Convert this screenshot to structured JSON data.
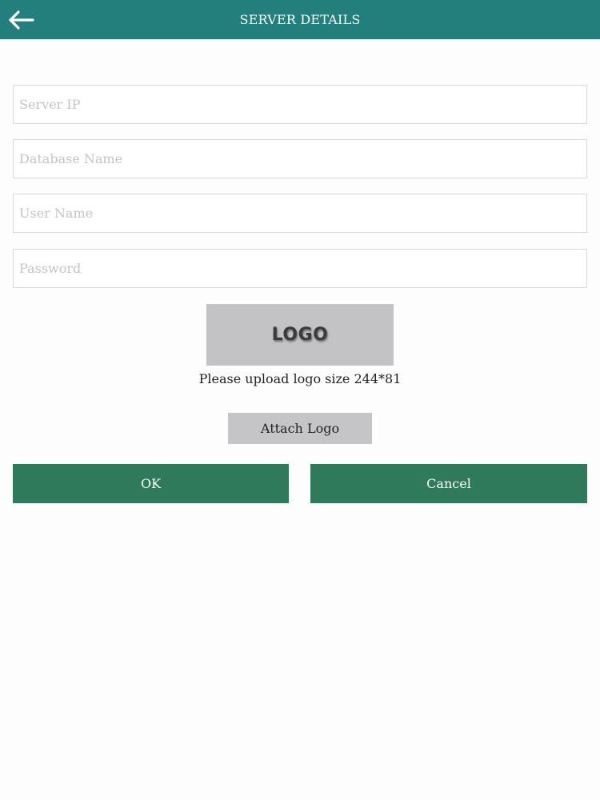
{
  "header": {
    "title": "SERVER DETAILS",
    "back_icon": "arrow-left-icon"
  },
  "form": {
    "server_ip": {
      "placeholder": "Server IP",
      "value": ""
    },
    "database_name": {
      "placeholder": "Database Name",
      "value": ""
    },
    "user_name": {
      "placeholder": "User Name",
      "value": ""
    },
    "password": {
      "placeholder": "Password",
      "value": ""
    }
  },
  "logo": {
    "placeholder_text": "LOGO",
    "caption": "Please upload logo size 244*81",
    "attach_label": "Attach Logo"
  },
  "actions": {
    "ok_label": "OK",
    "cancel_label": "Cancel"
  },
  "colors": {
    "header_bg": "#237f7b",
    "button_bg": "#2e7a5b",
    "logo_bg": "#c3c3c5"
  }
}
